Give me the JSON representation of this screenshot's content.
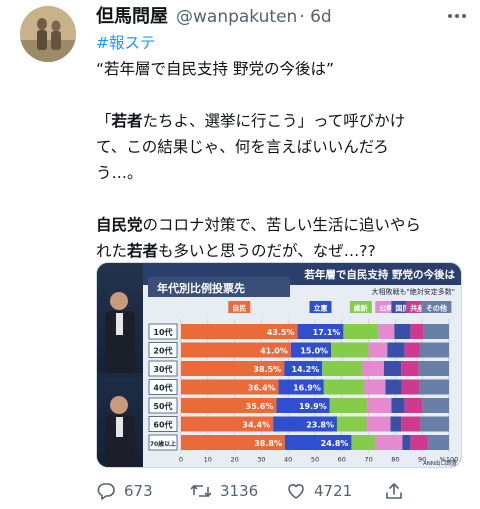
{
  "tweet": {
    "author_name": "但馬問屋",
    "handle": "@wanpakuten",
    "time": "· 6d",
    "hashtag": "#報ステ",
    "lines": {
      "l1": "“若年層で自民支持 野党の今後は”",
      "l2a": "「",
      "l2b": "若者",
      "l2c": "たちよ、選挙に行こう」って呼びかけ",
      "l3": "て、この結果じゃ、何を言えばいいんだろ",
      "l4": "う…。",
      "l5a": "自民党",
      "l5b": "のコロナ対策で、苦しい生活に追いやら",
      "l6a": "れた",
      "l6b": "若者",
      "l6c": "も多いと思うのだが、なぜ…??"
    }
  },
  "media": {
    "banner": "若年層で自民支持 野党の今後は",
    "subbanner": "大相敗戦も\"絶対安定多数\"",
    "chart_title": "年代別比例投票先",
    "credit": "ANN出口調査"
  },
  "chart_data": {
    "type": "bar",
    "stacked": true,
    "title": "年代別比例投票先",
    "categories": [
      "10代",
      "20代",
      "30代",
      "40代",
      "50代",
      "60代",
      "70歳以上"
    ],
    "series": [
      {
        "name": "自民",
        "color": "#ea6a3a",
        "values": [
          43.5,
          41.0,
          38.5,
          36.4,
          35.6,
          34.4,
          38.8
        ]
      },
      {
        "name": "立憲",
        "color": "#2f4fcf",
        "values": [
          17.1,
          15.0,
          14.2,
          16.9,
          19.9,
          23.8,
          24.8
        ]
      },
      {
        "name": "維新",
        "color": "#84cc4a",
        "values": [
          13.0,
          14.0,
          15.0,
          15.0,
          14.0,
          11.0,
          9.0
        ]
      },
      {
        "name": "公明",
        "color": "#e58ad0",
        "values": [
          6.0,
          7.0,
          8.0,
          8.0,
          9.0,
          9.0,
          10.0
        ]
      },
      {
        "name": "国民",
        "color": "#3a4fa8",
        "values": [
          6.0,
          6.5,
          6.5,
          6.0,
          5.0,
          4.0,
          3.0
        ]
      },
      {
        "name": "共産",
        "color": "#cf3a8e",
        "values": [
          5.0,
          5.5,
          6.5,
          6.5,
          6.5,
          7.0,
          6.5
        ]
      },
      {
        "name": "その他",
        "color": "#6a7fa8",
        "values": [
          9.4,
          11.0,
          11.3,
          11.2,
          10.0,
          10.8,
          7.9
        ]
      }
    ],
    "labeled": {
      "自民": [
        "43.5",
        "41.0",
        "38.5",
        "36.4",
        "35.6",
        "34.4",
        "38.8"
      ],
      "立憲": [
        "17.1",
        "15.0",
        "14.2",
        "16.9",
        "19.9",
        "23.8",
        "24.8"
      ]
    },
    "xlim": [
      0,
      100
    ],
    "xticks": [
      "0",
      "10",
      "20",
      "30",
      "40",
      "50",
      "60",
      "70",
      "80",
      "90",
      "%100"
    ],
    "legend": "top"
  },
  "actions": {
    "reply_count": "673",
    "retweet_count": "3136",
    "like_count": "4721"
  },
  "colors": {
    "link": "#1d9bf0",
    "muted": "#536471",
    "text": "#0f1419"
  }
}
